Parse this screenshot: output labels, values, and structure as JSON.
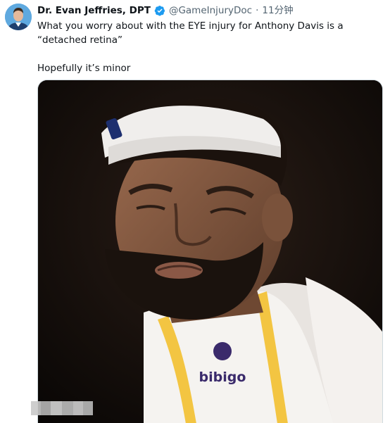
{
  "tweet": {
    "author": {
      "display_name": "Dr. Evan Jeffries, DPT",
      "handle": "@GameInjuryDoc",
      "verified": true,
      "avatar_icon": "profile-avatar"
    },
    "separator": "·",
    "timestamp": "11分钟",
    "text_line_1": "What you worry about with the EYE injury for Anthony Davis is a “detached retina”",
    "text_line_2": "Hopefully it’s minor",
    "media": {
      "type": "photo",
      "jersey_sponsor": "bibigo"
    }
  },
  "colors": {
    "verified_blue": "#1d9bf0",
    "secondary_text": "#536471",
    "primary_text": "#0f1419",
    "jersey_white": "#f5f3f0",
    "jersey_gold": "#f3c542",
    "jersey_purple": "#3a2a6b"
  }
}
